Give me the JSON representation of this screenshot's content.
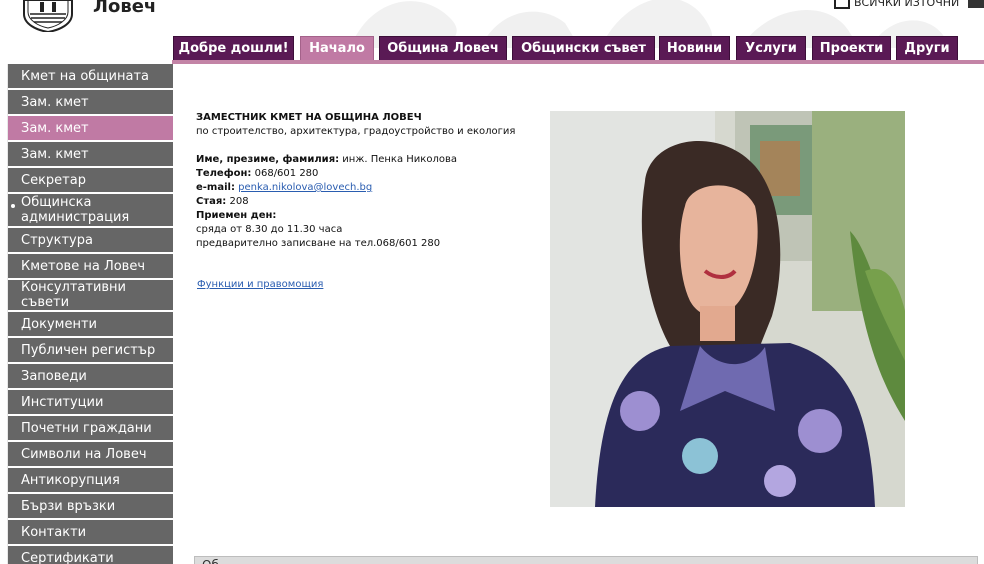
{
  "header": {
    "site_title": "Ловеч",
    "all_sources_label": "всички източни"
  },
  "topnav": {
    "tabs": [
      {
        "label": "Добре дошли!",
        "active": false
      },
      {
        "label": "Начало",
        "active": true
      },
      {
        "label": "Община Ловеч",
        "active": false
      },
      {
        "label": "Общински съвет",
        "active": false
      },
      {
        "label": "Новини",
        "active": false
      },
      {
        "label": "Услуги",
        "active": false
      },
      {
        "label": "Проекти",
        "active": false
      },
      {
        "label": "Други",
        "active": false
      }
    ]
  },
  "sidebar": {
    "items": [
      {
        "label": "Кмет на общината",
        "active": false
      },
      {
        "label": "Зам. кмет",
        "active": false
      },
      {
        "label": "Зам. кмет",
        "active": true
      },
      {
        "label": "Зам. кмет",
        "active": false
      },
      {
        "label": "Секретар",
        "active": false
      },
      {
        "label": "Общинска администрация",
        "active": false
      },
      {
        "label": "Структура",
        "active": false
      },
      {
        "label": "Кметове на Ловеч",
        "active": false
      },
      {
        "label": "Консултативни съвети",
        "active": false
      },
      {
        "label": "Документи",
        "active": false
      },
      {
        "label": "Публичен регистър",
        "active": false
      },
      {
        "label": "Заповеди",
        "active": false
      },
      {
        "label": "Институции",
        "active": false
      },
      {
        "label": "Почетни граждани",
        "active": false
      },
      {
        "label": "Символи на Ловеч",
        "active": false
      },
      {
        "label": "Антикорупция",
        "active": false
      },
      {
        "label": "Бързи връзки",
        "active": false
      },
      {
        "label": "Контакти",
        "active": false
      },
      {
        "label": "Сертификати",
        "active": false
      }
    ]
  },
  "content": {
    "heading": "ЗАМЕСТНИК КМЕТ НА ОБЩИНА ЛОВЕЧ",
    "subheading": "по  строителство, архитектура, градоустройство и екология",
    "name_label": "Име, презиме, фамилия:",
    "name_value": " инж. Пенка Николова",
    "phone_label": "Телефон:",
    "phone_value": " 068/601 280",
    "email_label": "e-mail:",
    "email_value": "penka.nikolova@lovech.bg",
    "room_label": "Стая:",
    "room_value": " 208",
    "hours_label": "Приемен ден:",
    "hours_line1": "сряда от 8.30 до 11.30 часа",
    "hours_line2": "предварително записване на тел.068/601 280",
    "functions_link": "Функции и правомощия"
  },
  "bottom": {
    "label": "Об"
  },
  "colors": {
    "nav_tab": "#5a1a55",
    "nav_active": "#c07aa4",
    "sidebar_item": "#666666",
    "sidebar_active": "#c07aa4",
    "link": "#2a5db0"
  }
}
